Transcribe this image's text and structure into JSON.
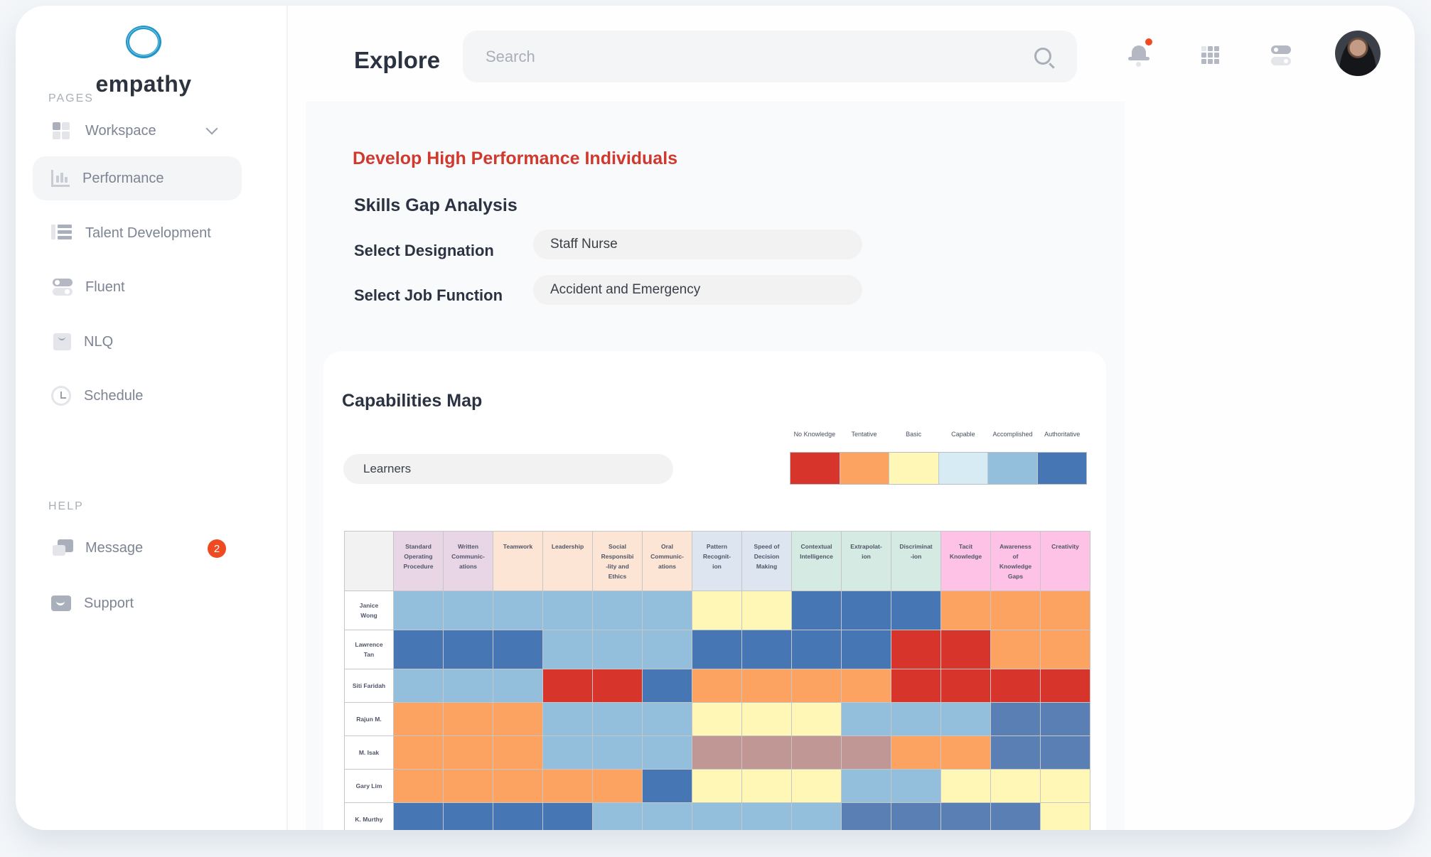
{
  "brand": {
    "name": "empathy",
    "logo_color": "#1e96c8"
  },
  "sidebar": {
    "pages_label": "PAGES",
    "help_label": "HELP",
    "items": [
      {
        "label": "Workspace",
        "icon": "workspace-icon",
        "has_chevron": true
      },
      {
        "label": "Performance",
        "icon": "performance-icon",
        "active": true
      },
      {
        "label": "Talent Development",
        "icon": "talent-development-icon"
      },
      {
        "label": "Fluent",
        "icon": "fluent-icon"
      },
      {
        "label": "NLQ",
        "icon": "nlq-icon"
      },
      {
        "label": "Schedule",
        "icon": "schedule-icon"
      }
    ],
    "help_items": [
      {
        "label": "Message",
        "icon": "message-icon",
        "badge": "2"
      },
      {
        "label": "Support",
        "icon": "support-icon"
      }
    ]
  },
  "header": {
    "title": "Explore",
    "search_placeholder": "Search",
    "search_value": "",
    "icons": [
      "bell-icon",
      "apps-grid-icon",
      "toggle-settings-icon",
      "user-avatar"
    ],
    "notification_dot": true
  },
  "main": {
    "goal_title": "Develop High Performance Individuals",
    "section_title": "Skills Gap Analysis",
    "designation_label": "Select Designation",
    "designation_value": "Staff Nurse",
    "job_function_label": "Select Job Function",
    "job_function_value": "Accident and Emergency"
  },
  "capabilities": {
    "title": "Capabilities Map",
    "learners_value": "Learners"
  },
  "chart_data": {
    "type": "heatmap",
    "title": "Capabilities Map",
    "legend": [
      {
        "level": 1,
        "label": "No Knowledge",
        "color": "#d7352b"
      },
      {
        "level": 2,
        "label": "Tentative",
        "color": "#fca362"
      },
      {
        "level": 3,
        "label": "Basic",
        "color": "#fef7b5"
      },
      {
        "level": 4,
        "label": "Capable",
        "color": "#d6ebf3"
      },
      {
        "level": 5,
        "label": "Accomplished",
        "color": "#93bedc"
      },
      {
        "level": 6,
        "label": "Authoritative",
        "color": "#4676b4"
      }
    ],
    "extra_colors": {
      "6m": "#5a7fb4",
      "m": "#c09794"
    },
    "columns": [
      {
        "label": "Standard\nOperating\nProcedure",
        "group_color": "#e8d6e7"
      },
      {
        "label": "Written\nCommunic-\nations",
        "group_color": "#e8d6e7"
      },
      {
        "label": "Teamwork",
        "group_color": "#fce5d4"
      },
      {
        "label": "Leadership",
        "group_color": "#fce5d4"
      },
      {
        "label": "Social\nResponsibi\n-lity and\nEthics",
        "group_color": "#fce5d4"
      },
      {
        "label": "Oral\nCommunic-\nations",
        "group_color": "#fce5d4"
      },
      {
        "label": "Pattern\nRecognit-\nion",
        "group_color": "#dde5f1"
      },
      {
        "label": "Speed of\nDecision\nMaking",
        "group_color": "#dde5f1"
      },
      {
        "label": "Contextual\nIntelligence",
        "group_color": "#d5eae2"
      },
      {
        "label": "Extrapolat-\nion",
        "group_color": "#d5eae2"
      },
      {
        "label": "Discriminat\n-ion",
        "group_color": "#d5eae2"
      },
      {
        "label": "Tacit\nKnowledge",
        "group_color": "#fec2e6"
      },
      {
        "label": "Awareness\nof\nKnowledge\nGaps",
        "group_color": "#fec2e6"
      },
      {
        "label": "Creativity",
        "group_color": "#fec2e6"
      }
    ],
    "rows": [
      {
        "name": "Janice\nWong",
        "values": [
          5,
          5,
          5,
          5,
          5,
          5,
          3,
          3,
          6,
          6,
          6,
          2,
          2,
          2
        ]
      },
      {
        "name": "Lawrence\nTan",
        "values": [
          6,
          6,
          6,
          5,
          5,
          5,
          6,
          6,
          6,
          6,
          1,
          1,
          2,
          2
        ]
      },
      {
        "name": "Siti Faridah",
        "values": [
          5,
          5,
          5,
          1,
          1,
          6,
          2,
          2,
          2,
          2,
          1,
          1,
          1,
          1
        ]
      },
      {
        "name": "Rajun M.",
        "values": [
          2,
          2,
          2,
          5,
          5,
          5,
          3,
          3,
          3,
          5,
          5,
          5,
          "6m",
          "6m"
        ]
      },
      {
        "name": "M. Isak",
        "values": [
          2,
          2,
          2,
          5,
          5,
          5,
          "m",
          "m",
          "m",
          "m",
          2,
          2,
          "6m",
          "6m"
        ]
      },
      {
        "name": "Gary Lim",
        "values": [
          2,
          2,
          2,
          2,
          2,
          6,
          3,
          3,
          3,
          5,
          5,
          3,
          3,
          3
        ]
      },
      {
        "name": "K. Murthy",
        "values": [
          6,
          6,
          6,
          6,
          5,
          5,
          5,
          5,
          5,
          "6m",
          "6m",
          "6m",
          "6m",
          3
        ]
      }
    ]
  }
}
